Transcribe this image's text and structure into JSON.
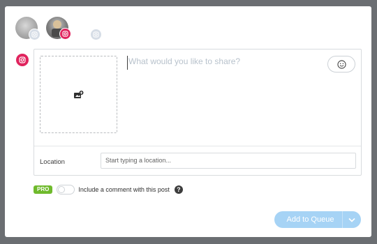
{
  "composer": {
    "placeholder": "What would you like to share?",
    "location_label": "Location",
    "location_placeholder": "Start typing a location..."
  },
  "comment_option": {
    "badge": "PRO",
    "label": "Include a comment with this post",
    "help": "?"
  },
  "actions": {
    "add_to_queue": "Add to Queue"
  },
  "colors": {
    "instagram": "#e0245e",
    "pro": "#6fba2c",
    "primary_disabled": "#a6d3f5"
  },
  "icons": {
    "channel": "instagram-icon",
    "media": "add-media-icon",
    "emoji": "smiley-icon",
    "caret": "chevron-down-icon"
  }
}
